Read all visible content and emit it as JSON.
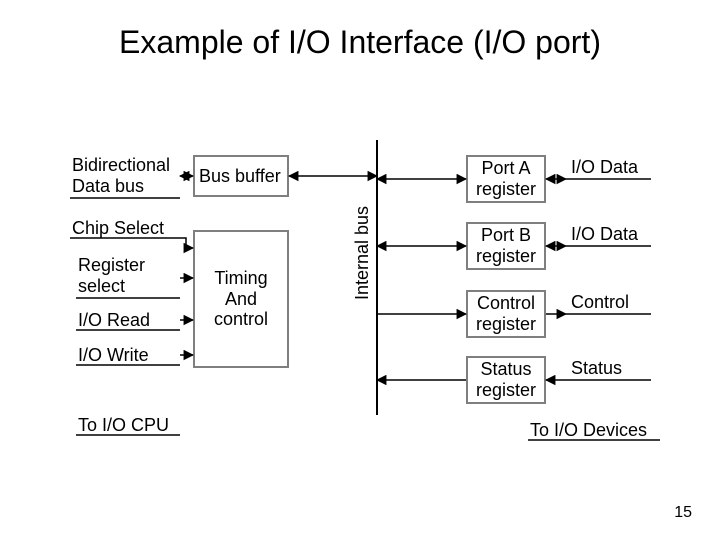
{
  "title": "Example of I/O Interface (I/O port)",
  "left": {
    "bidir": "Bidirectional\nData bus",
    "chip_select": "Chip Select",
    "register_select": "Register\nselect",
    "io_read": "I/O Read",
    "io_write": "I/O Write",
    "to_cpu": "To I/O CPU"
  },
  "blocks": {
    "bus_buffer": "Bus buffer",
    "timing": "Timing\nAnd\ncontrol",
    "internal_bus": "Internal bus"
  },
  "regs": {
    "port_a": "Port A\nregister",
    "port_b": "Port B\nregister",
    "control": "Control\nregister",
    "status": "Status\nregister"
  },
  "ext": {
    "io_data1": "I/O Data",
    "io_data2": "I/O Data",
    "control": "Control",
    "status": "Status",
    "to_devices": "To I/O Devices"
  },
  "page_number": "15"
}
